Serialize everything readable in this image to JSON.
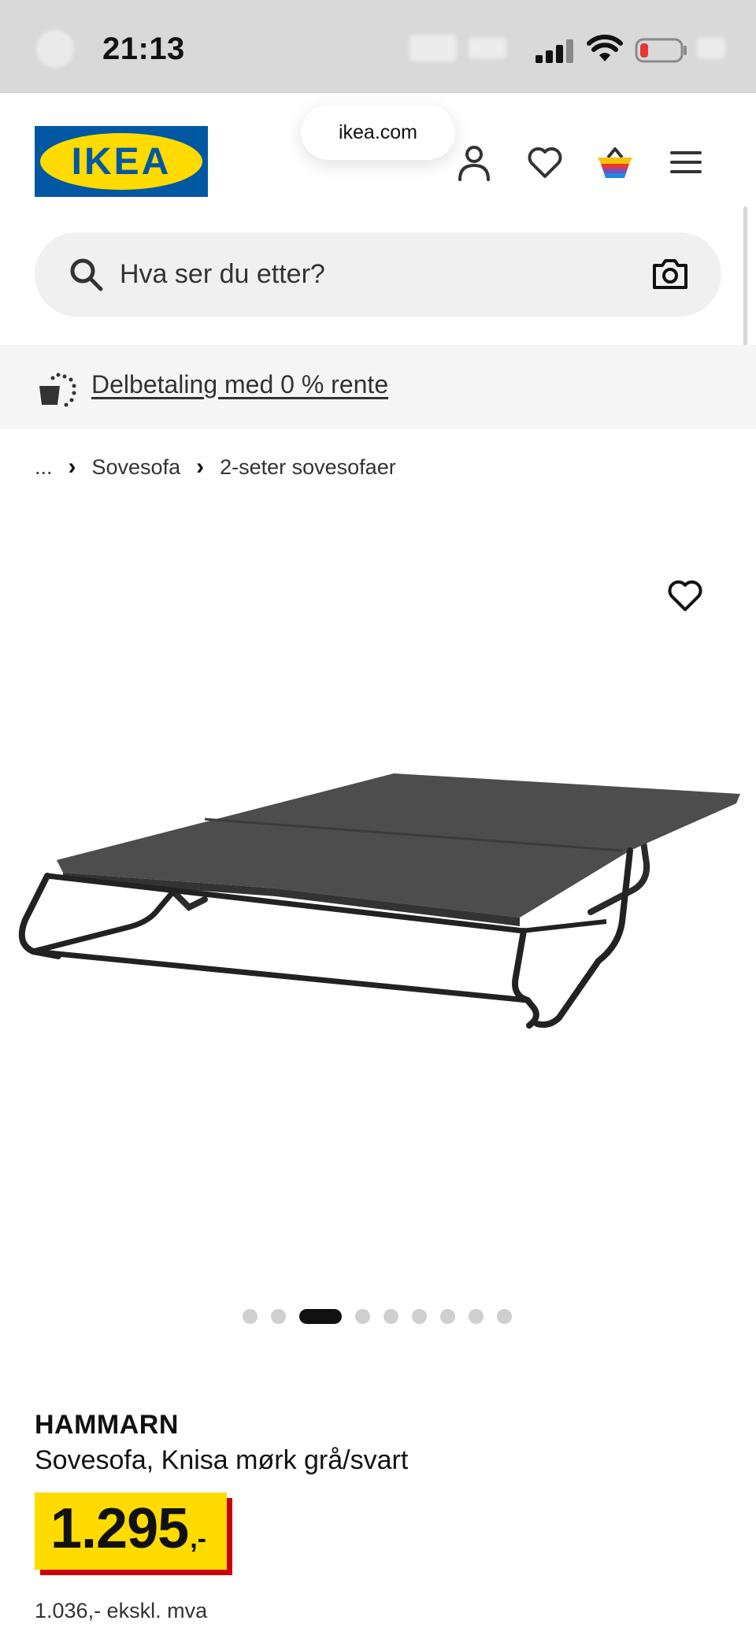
{
  "status_bar": {
    "time": "21:13"
  },
  "browser": {
    "url": "ikea.com"
  },
  "header": {
    "logo_text": "IKEA",
    "icons": [
      "account-icon",
      "heart-icon",
      "basket-icon",
      "menu-icon"
    ]
  },
  "search": {
    "placeholder": "Hva ser du etter?"
  },
  "promo": {
    "link_text": "Delbetaling med 0 % rente"
  },
  "breadcrumb": {
    "items": [
      "...",
      "Sovesofa",
      "2-seter sovesofaer"
    ]
  },
  "gallery": {
    "dot_count": 9,
    "active_index": 2
  },
  "product": {
    "brand": "HAMMARN",
    "description": "Sovesofa, Knisa mørk grå/svart",
    "price_main": "1.295",
    "price_suffix": ",-",
    "price_ex_vat": "1.036,- ekskl. mva"
  },
  "colors": {
    "ikea_blue": "#0058a3",
    "ikea_yellow": "#ffdb00",
    "price_red": "#cc0008"
  }
}
